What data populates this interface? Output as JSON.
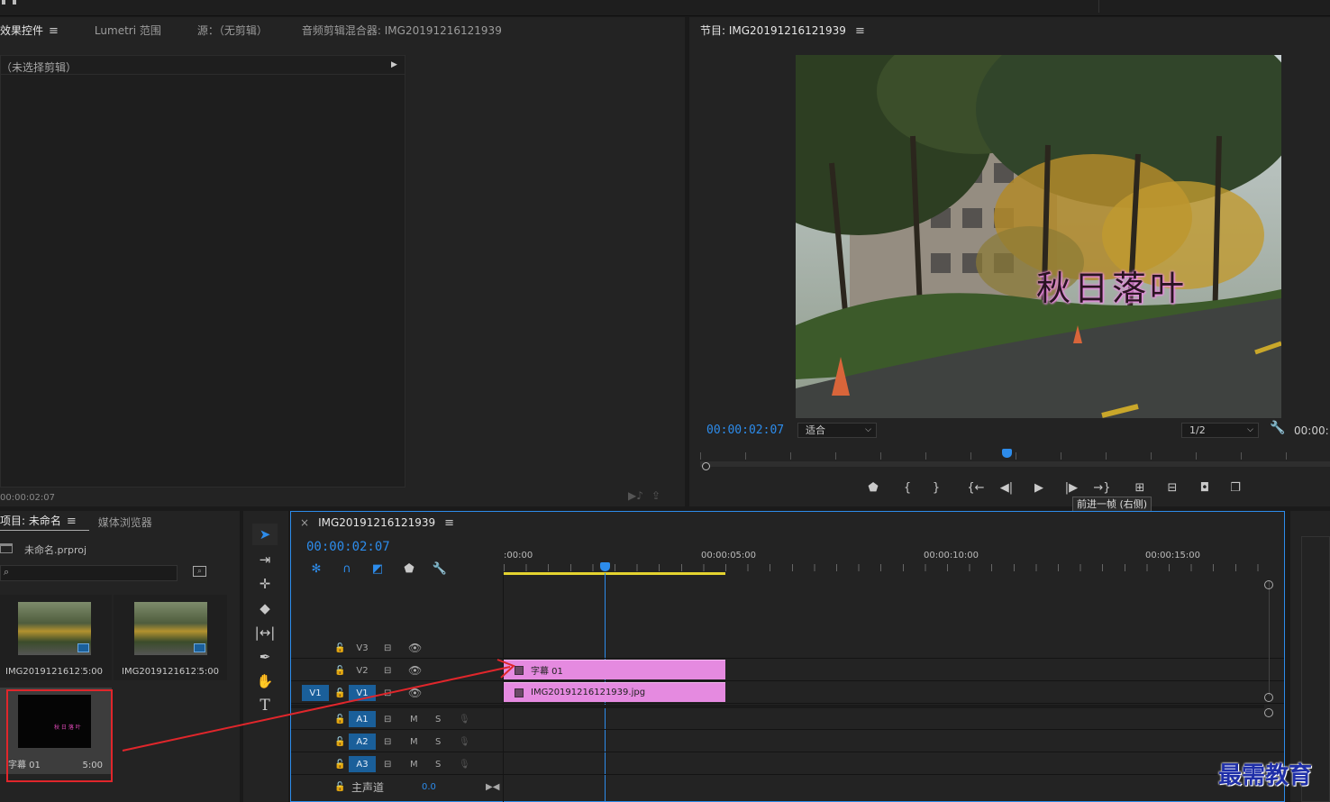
{
  "effects_panel": {
    "tabs": [
      "效果控件",
      "Lumetri 范围",
      "源：（无剪辑）",
      "音频剪辑混合器: IMG20191216121939"
    ],
    "menu_icon": "hamburger-icon",
    "no_clip": "（未选择剪辑）",
    "timecode": "00:00:02:07"
  },
  "program_monitor": {
    "title": "节目: IMG20191216121939",
    "overlay_text": "秋日落叶",
    "timecode": "00:00:02:07",
    "fit_select": "适合",
    "resolution_select": "1/2",
    "right_timecode": "00:00:",
    "tooltip": "前进一帧 (右侧)"
  },
  "project_panel": {
    "tabs": [
      "项目: 未命名",
      "媒体浏览器"
    ],
    "project_file": "未命名.prproj",
    "items": [
      {
        "name": "IMG20191216121...",
        "duration": "5:00"
      },
      {
        "name": "IMG20191216121...",
        "duration": "5:00"
      },
      {
        "name": "字幕 01",
        "duration": "5:00",
        "thumb_text": "秋 日 落 叶"
      }
    ]
  },
  "timeline": {
    "title": "IMG20191216121939",
    "close": "×",
    "timecode": "00:00:02:07",
    "ruler": [
      ":00:00",
      "00:00:05:00",
      "00:00:10:00",
      "00:00:15:00"
    ],
    "video_tracks": [
      "V3",
      "V2",
      "V1"
    ],
    "source_patch": "V1",
    "audio_tracks": [
      "A1",
      "A2",
      "A3"
    ],
    "mute": "M",
    "solo": "S",
    "master": {
      "label": "主声道",
      "value": "0.0"
    },
    "clips": {
      "v2": "字幕 01",
      "v1": "IMG20191216121939.jpg"
    }
  },
  "watermark": "最需教育",
  "colors": {
    "accent": "#2d8ceb",
    "clip": "#e58ae0",
    "annotation": "#e0262b"
  }
}
